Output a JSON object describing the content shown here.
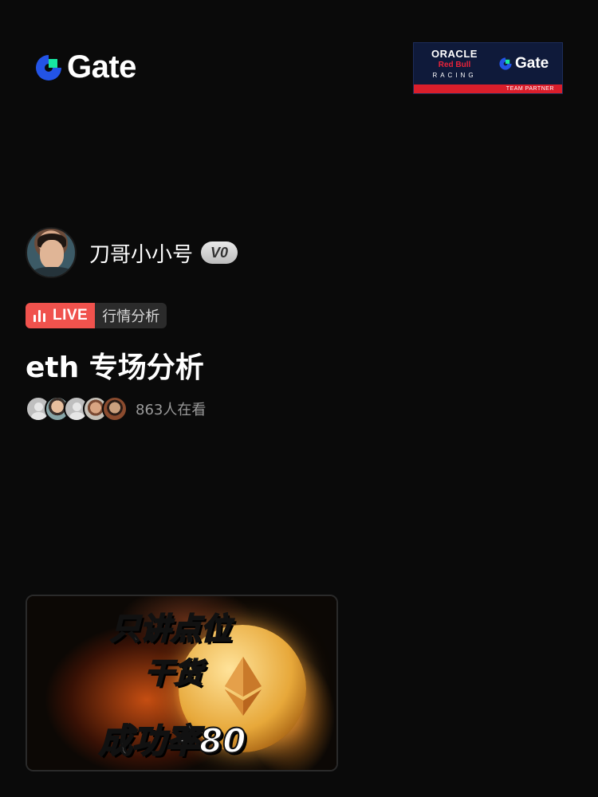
{
  "header": {
    "logo_text": "Gate",
    "partner": {
      "oracle": "ORACLE",
      "redbull": "Red Bull",
      "racing": "RACING",
      "gate": "Gate",
      "strip": "TEAM PARTNER"
    }
  },
  "host": {
    "name": "刀哥小小号",
    "vip_level": "V0"
  },
  "tags": {
    "live": "LIVE",
    "category": "行情分析"
  },
  "stream": {
    "title": "eth 专场分析",
    "viewer_count": "863人在看"
  },
  "thumbnail": {
    "line1": "只讲点位",
    "line2": "干货",
    "line3": "成功率80"
  },
  "colors": {
    "background": "#0a0a0a",
    "live_red": "#f0524d",
    "gate_blue": "#2354e6",
    "gate_green": "#17e6a1"
  }
}
